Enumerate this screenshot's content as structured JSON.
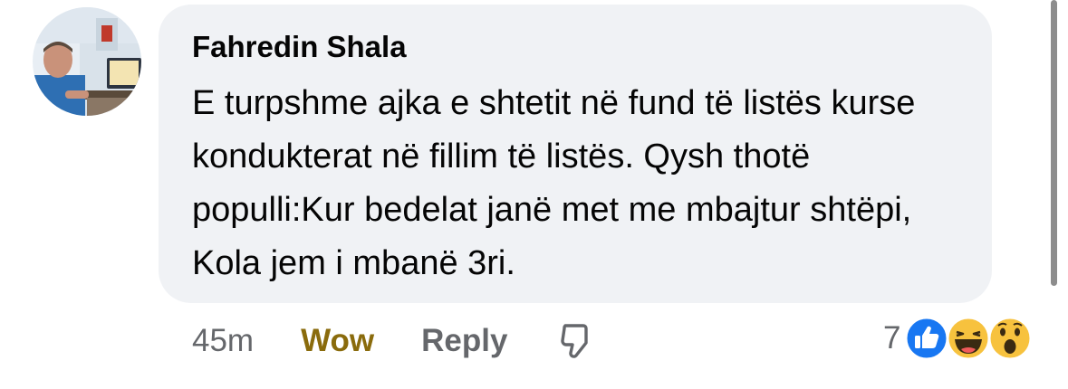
{
  "comment": {
    "author": "Fahredin Shala",
    "text": "E turpshme ajka e shtetit në fund të listës kurse kondukterat në fillim të listës. Qysh thotë populli:Kur bedelat janë met me mbajtur shtëpi, Kola jem i mbanë 3ri.",
    "time": "45m",
    "reaction_label": "Wow",
    "reply_label": "Reply",
    "reaction_count": "7"
  },
  "icons": {
    "dislike": "thumbs-down-outline-icon",
    "reactions": [
      "like-icon",
      "haha-icon",
      "wow-icon"
    ]
  },
  "colors": {
    "bubble": "#f0f2f5",
    "wow_label": "#8a6b0c",
    "muted": "#65676b",
    "like_blue": "#1877f2",
    "emoji_yellow": "#f7c23e"
  }
}
